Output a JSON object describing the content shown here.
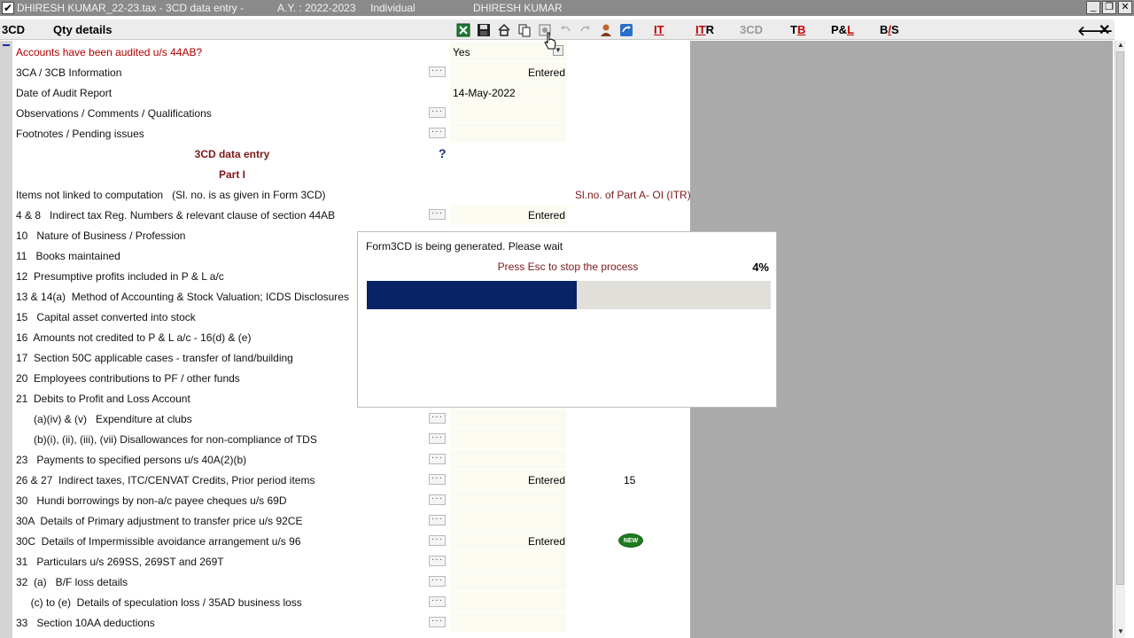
{
  "titlebar": {
    "check": "✔",
    "file": "DHIRESH KUMAR_22-23.tax - 3CD data entry -",
    "ay": "A.Y. : 2022-2023",
    "type": "Individual",
    "name": "DHIRESH KUMAR",
    "min": "_",
    "restore": "❐",
    "close": "✕"
  },
  "toolbar": {
    "code": "3CD",
    "section": "Qty details",
    "tabs": [
      {
        "pre": "",
        "hot": "IT",
        "post": "",
        "dim": false
      },
      {
        "pre": "",
        "hot": "IT",
        "post": "R",
        "dim": false
      },
      {
        "pre": "3CD",
        "hot": "",
        "post": "",
        "dim": true
      },
      {
        "pre": "T",
        "hot": "B",
        "post": "",
        "dim": false
      },
      {
        "pre": "P&",
        "hot": "L",
        "post": "",
        "dim": false
      },
      {
        "pre": "B",
        "hot": "/",
        "post": "S",
        "dim": false
      }
    ],
    "back": "🡐",
    "close": "✕"
  },
  "rows": [
    {
      "label": "Accounts have been audited u/s 44AB?",
      "style": "red",
      "value": "Yes",
      "dropdown": true
    },
    {
      "label": "3CA / 3CB Information",
      "dots": true,
      "value": "Entered",
      "value_align": "right"
    },
    {
      "label": "Date of Audit Report",
      "value": "14-May-2022"
    },
    {
      "label": "Observations / Comments / Qualifications",
      "dots": true,
      "value": ""
    },
    {
      "label": "Footnotes / Pending issues",
      "dots": true,
      "value": ""
    },
    {
      "label": "3CD data entry",
      "style": "center",
      "help": "?"
    },
    {
      "label": "Part I",
      "style": "center"
    },
    {
      "label": "Items not linked to computation   (Sl. no. is as given in Form 3CD)",
      "sl": "Sl.no. of Part A- OI (ITR)"
    },
    {
      "label": "4 & 8   Indirect tax Reg. Numbers & relevant clause of section 44AB",
      "dots": true,
      "value": "Entered",
      "value_align": "right"
    },
    {
      "label": "10   Nature of Business / Profession"
    },
    {
      "label": "11   Books maintained"
    },
    {
      "label": "12  Presumptive profits included in P & L a/c"
    },
    {
      "label": "13 & 14(a)  Method of Accounting & Stock Valuation; ICDS Disclosures"
    },
    {
      "label": "15   Capital asset converted into stock"
    },
    {
      "label": "16  Amounts not credited to P & L a/c - 16(d) & (e)"
    },
    {
      "label": "17  Section 50C applicable cases - transfer of land/building"
    },
    {
      "label": "20  Employees contributions to PF / other funds"
    },
    {
      "label": "21  Debits to Profit and Loss Account"
    },
    {
      "label": "      (a)(iv) & (v)   Expenditure at clubs",
      "dots": true,
      "value": ""
    },
    {
      "label": "      (b)(i), (ii), (iii), (vii) Disallowances for non-compliance of TDS",
      "dots": true,
      "value": ""
    },
    {
      "label": "23   Payments to specified persons u/s 40A(2)(b)",
      "dots": true,
      "value": ""
    },
    {
      "label": "26 & 27  Indirect taxes, ITC/CENVAT Credits, Prior period items",
      "dots": true,
      "value": "Entered",
      "value_align": "right",
      "slval": "15"
    },
    {
      "label": "30   Hundi borrowings by non-a/c payee cheques u/s 69D",
      "dots": true,
      "value": ""
    },
    {
      "label": "30A  Details of Primary adjustment to transfer price u/s 92CE",
      "dots": true,
      "value": ""
    },
    {
      "label": "30C  Details of Impermissible avoidance arrangement u/s 96",
      "dots": true,
      "value": "Entered",
      "value_align": "right",
      "badge": "NEW"
    },
    {
      "label": "31   Particulars u/s 269SS, 269ST and 269T",
      "dots": true,
      "value": ""
    },
    {
      "label": "32  (a)   B/F loss details",
      "dots": true,
      "value": ""
    },
    {
      "label": "     (c) to (e)  Details of speculation loss / 35AD business loss",
      "dots": true,
      "value": ""
    },
    {
      "label": "33   Section 10AA deductions",
      "dots": true,
      "value": ""
    }
  ],
  "dialog": {
    "message": "Form3CD is being generated. Please wait",
    "esc": "Press Esc to stop the process",
    "percent_label": "4%",
    "progress_fraction": 0.52
  }
}
